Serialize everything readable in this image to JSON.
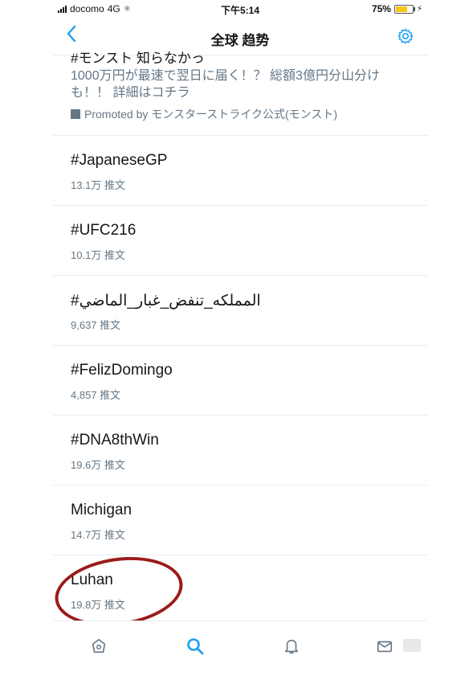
{
  "status": {
    "carrier": "docomo",
    "network": "4G",
    "time": "下午5:14",
    "battery": "75%",
    "battery_level": 0.75
  },
  "nav": {
    "title": "全球 趋势",
    "back_icon": "chevron-left-icon",
    "settings_icon": "gear-icon",
    "accent": "#1da1f2"
  },
  "promo": {
    "cut_line": "#モンスト 知らなかっ",
    "text": "1000万円が最速で翌日に届く！？ 総額3億円分山分けも！！ 詳細はコチラ",
    "by": "Promoted by モンスターストライク公式(モンスト)"
  },
  "trends": [
    {
      "name": "#JapaneseGP",
      "count": "13.1万 推文"
    },
    {
      "name": "#UFC216",
      "count": "10.1万 推文"
    },
    {
      "name": "#المملكه_تنفض_غبار_الماضي",
      "count": "9,637 推文"
    },
    {
      "name": "#FelizDomingo",
      "count": "4,857 推文"
    },
    {
      "name": "#DNA8thWin",
      "count": "19.6万 推文"
    },
    {
      "name": "Michigan",
      "count": "14.7万 推文"
    },
    {
      "name": "Luhan",
      "count": "19.8万 推文"
    }
  ],
  "tabs": [
    {
      "name": "home-icon",
      "active": false
    },
    {
      "name": "search-icon",
      "active": true
    },
    {
      "name": "bell-icon",
      "active": false
    },
    {
      "name": "mail-icon",
      "active": false
    }
  ],
  "colors": {
    "annotation": "#9b1b1b",
    "text_primary": "#14171a",
    "text_secondary": "#657786"
  }
}
